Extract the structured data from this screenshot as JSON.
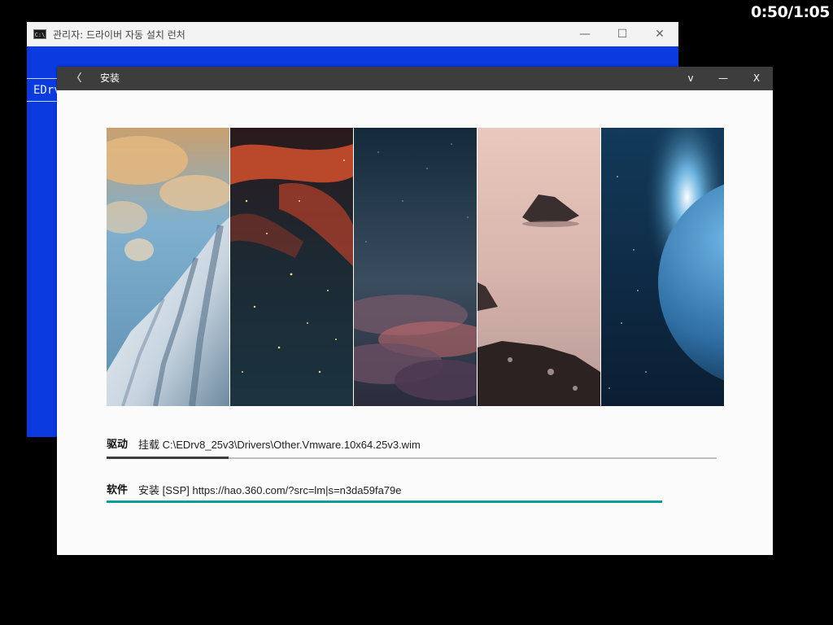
{
  "timer": "0:50/1:05",
  "console_window": {
    "title": "관리자: 드라이버 자동 설치 런처",
    "icon_label": "C:\\",
    "line_text": "EDrv",
    "controls": {
      "minimize": "—",
      "maximize": "☐",
      "close": "✕"
    }
  },
  "installer_window": {
    "title": "安装",
    "back_label": "〈",
    "controls": {
      "dropdown": "v",
      "minimize": "—",
      "close": "X"
    },
    "gallery": {
      "panels": [
        "snow-mountain",
        "nebula",
        "cloudy-night-sky",
        "misty-sea-rocks",
        "earth-from-space"
      ]
    },
    "driver_row": {
      "label": "驱动",
      "status": "挂载 C:\\EDrv8_25v3\\Drivers\\Other.Vmware.10x64.25v3.wim",
      "progress": 0.2
    },
    "software_row": {
      "label": "软件",
      "status": "安装 [SSP] https://hao.360.com/?src=lm|s=n3da59fa79e",
      "progress": 0.91
    },
    "colors": {
      "titlebar": "#3d3d3d",
      "driver_progress": "#3c3c3c",
      "driver_track": "#bdbdbd",
      "software_progress": "#0f9c9c",
      "console_bg": "#0a3ae0"
    }
  }
}
